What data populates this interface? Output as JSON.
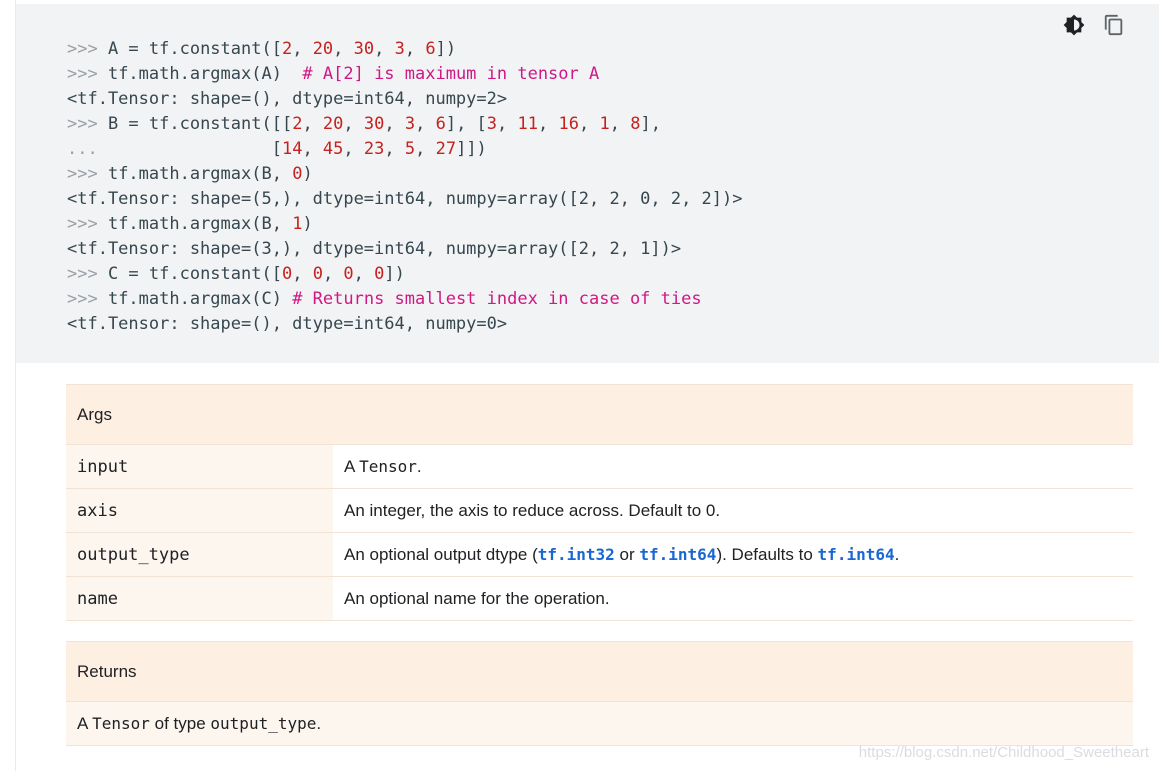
{
  "code_lines": [
    [
      {
        "t": ">>> ",
        "c": "pr"
      },
      {
        "t": "A = tf.constant([",
        "c": ""
      },
      {
        "t": "2",
        "c": "num"
      },
      {
        "t": ", ",
        "c": ""
      },
      {
        "t": "20",
        "c": "num"
      },
      {
        "t": ", ",
        "c": ""
      },
      {
        "t": "30",
        "c": "num"
      },
      {
        "t": ", ",
        "c": ""
      },
      {
        "t": "3",
        "c": "num"
      },
      {
        "t": ", ",
        "c": ""
      },
      {
        "t": "6",
        "c": "num"
      },
      {
        "t": "])",
        "c": ""
      }
    ],
    [
      {
        "t": ">>> ",
        "c": "pr"
      },
      {
        "t": "tf.math.argmax(A)  ",
        "c": ""
      },
      {
        "t": "# A[2] is maximum in tensor A",
        "c": "cm"
      }
    ],
    [
      {
        "t": "<tf.Tensor: shape=(), dtype=int64, numpy=2>",
        "c": ""
      }
    ],
    [
      {
        "t": ">>> ",
        "c": "pr"
      },
      {
        "t": "B = tf.constant([[",
        "c": ""
      },
      {
        "t": "2",
        "c": "num"
      },
      {
        "t": ", ",
        "c": ""
      },
      {
        "t": "20",
        "c": "num"
      },
      {
        "t": ", ",
        "c": ""
      },
      {
        "t": "30",
        "c": "num"
      },
      {
        "t": ", ",
        "c": ""
      },
      {
        "t": "3",
        "c": "num"
      },
      {
        "t": ", ",
        "c": ""
      },
      {
        "t": "6",
        "c": "num"
      },
      {
        "t": "], [",
        "c": ""
      },
      {
        "t": "3",
        "c": "num"
      },
      {
        "t": ", ",
        "c": ""
      },
      {
        "t": "11",
        "c": "num"
      },
      {
        "t": ", ",
        "c": ""
      },
      {
        "t": "16",
        "c": "num"
      },
      {
        "t": ", ",
        "c": ""
      },
      {
        "t": "1",
        "c": "num"
      },
      {
        "t": ", ",
        "c": ""
      },
      {
        "t": "8",
        "c": "num"
      },
      {
        "t": "],",
        "c": ""
      }
    ],
    [
      {
        "t": "...                 ",
        "c": "pr"
      },
      {
        "t": "[",
        "c": ""
      },
      {
        "t": "14",
        "c": "num"
      },
      {
        "t": ", ",
        "c": ""
      },
      {
        "t": "45",
        "c": "num"
      },
      {
        "t": ", ",
        "c": ""
      },
      {
        "t": "23",
        "c": "num"
      },
      {
        "t": ", ",
        "c": ""
      },
      {
        "t": "5",
        "c": "num"
      },
      {
        "t": ", ",
        "c": ""
      },
      {
        "t": "27",
        "c": "num"
      },
      {
        "t": "]])",
        "c": ""
      }
    ],
    [
      {
        "t": ">>> ",
        "c": "pr"
      },
      {
        "t": "tf.math.argmax(B, ",
        "c": ""
      },
      {
        "t": "0",
        "c": "num"
      },
      {
        "t": ")",
        "c": ""
      }
    ],
    [
      {
        "t": "<tf.Tensor: shape=(5,), dtype=int64, numpy=array([2, 2, 0, 2, 2])>",
        "c": ""
      }
    ],
    [
      {
        "t": ">>> ",
        "c": "pr"
      },
      {
        "t": "tf.math.argmax(B, ",
        "c": ""
      },
      {
        "t": "1",
        "c": "num"
      },
      {
        "t": ")",
        "c": ""
      }
    ],
    [
      {
        "t": "<tf.Tensor: shape=(3,), dtype=int64, numpy=array([2, 2, 1])>",
        "c": ""
      }
    ],
    [
      {
        "t": ">>> ",
        "c": "pr"
      },
      {
        "t": "C = tf.constant([",
        "c": ""
      },
      {
        "t": "0",
        "c": "num"
      },
      {
        "t": ", ",
        "c": ""
      },
      {
        "t": "0",
        "c": "num"
      },
      {
        "t": ", ",
        "c": ""
      },
      {
        "t": "0",
        "c": "num"
      },
      {
        "t": ", ",
        "c": ""
      },
      {
        "t": "0",
        "c": "num"
      },
      {
        "t": "])",
        "c": ""
      }
    ],
    [
      {
        "t": ">>> ",
        "c": "pr"
      },
      {
        "t": "tf.math.argmax(C) ",
        "c": ""
      },
      {
        "t": "# Returns smallest index in case of ties",
        "c": "cm"
      }
    ],
    [
      {
        "t": "<tf.Tensor: shape=(), dtype=int64, numpy=0>",
        "c": ""
      }
    ]
  ],
  "toolbar": {
    "theme_icon": "theme-toggle-icon",
    "copy_icon": "copy-icon"
  },
  "args": {
    "header": "Args",
    "rows": [
      {
        "name": "input",
        "desc": [
          {
            "t": "A ",
            "c": ""
          },
          {
            "t": "Tensor",
            "c": "mono"
          },
          {
            "t": ".",
            "c": ""
          }
        ]
      },
      {
        "name": "axis",
        "desc": [
          {
            "t": "An integer, the axis to reduce across. Default to 0.",
            "c": ""
          }
        ]
      },
      {
        "name": "output_type",
        "desc": [
          {
            "t": "An optional output dtype (",
            "c": ""
          },
          {
            "t": "tf.int32",
            "c": "lnk"
          },
          {
            "t": " or ",
            "c": ""
          },
          {
            "t": "tf.int64",
            "c": "lnk"
          },
          {
            "t": "). Defaults to ",
            "c": ""
          },
          {
            "t": "tf.int64",
            "c": "lnk"
          },
          {
            "t": ".",
            "c": ""
          }
        ]
      },
      {
        "name": "name",
        "desc": [
          {
            "t": "An optional name for the operation.",
            "c": ""
          }
        ]
      }
    ]
  },
  "returns": {
    "header": "Returns",
    "desc": [
      {
        "t": "A ",
        "c": ""
      },
      {
        "t": "Tensor",
        "c": "mono"
      },
      {
        "t": " of type ",
        "c": ""
      },
      {
        "t": "output_type",
        "c": "mono"
      },
      {
        "t": ".",
        "c": ""
      }
    ]
  },
  "watermark": "https://blog.csdn.net/Childhood_Sweetheart",
  "colors": {
    "code_bg": "#f1f3f4",
    "number": "#c5221f",
    "comment": "#d01884",
    "link": "#1967d2",
    "table_header": "#fdefe2"
  }
}
